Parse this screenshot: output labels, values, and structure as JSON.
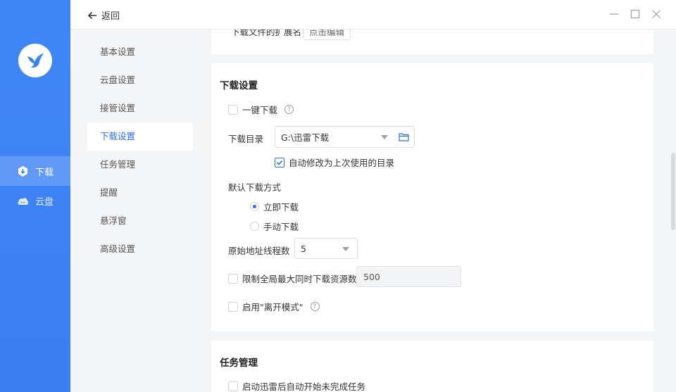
{
  "rail": {
    "items": [
      {
        "label": "下载",
        "icon": "download-icon"
      },
      {
        "label": "云盘",
        "icon": "cloud-icon"
      }
    ]
  },
  "topbar": {
    "back_label": "返回"
  },
  "nav": {
    "items": [
      {
        "label": "基本设置"
      },
      {
        "label": "云盘设置"
      },
      {
        "label": "接管设置"
      },
      {
        "label": "下载设置"
      },
      {
        "label": "任务管理"
      },
      {
        "label": "提醒"
      },
      {
        "label": "悬浮窗"
      },
      {
        "label": "高级设置"
      }
    ],
    "active_index": 3
  },
  "prev_card": {
    "partial_label": "下载文件的扩展名",
    "partial_button": "点击编辑"
  },
  "download_settings": {
    "title": "下载设置",
    "one_click_label": "一键下载",
    "one_click_checked": false,
    "dir_label": "下载目录",
    "dir_value": "G:\\迅雷下载",
    "auto_modify_label": "自动修改为上次使用的目录",
    "auto_modify_checked": true,
    "default_mode_label": "默认下载方式",
    "mode_immediate": "立即下载",
    "mode_manual": "手动下载",
    "mode_selected": "立即下载",
    "threads_label": "原始地址线程数",
    "threads_value": "5",
    "limit_label": "限制全局最大同时下载资源数",
    "limit_value": "500",
    "limit_checked": false,
    "away_mode_label": "启用\"离开模式\"",
    "away_mode_checked": false
  },
  "task_management": {
    "title": "任务管理",
    "auto_start_label": "启动迅雷后自动开始未完成任务",
    "auto_start_checked": false
  },
  "colors": {
    "accent": "#2b6fe6",
    "rail": "#3b82f6"
  }
}
